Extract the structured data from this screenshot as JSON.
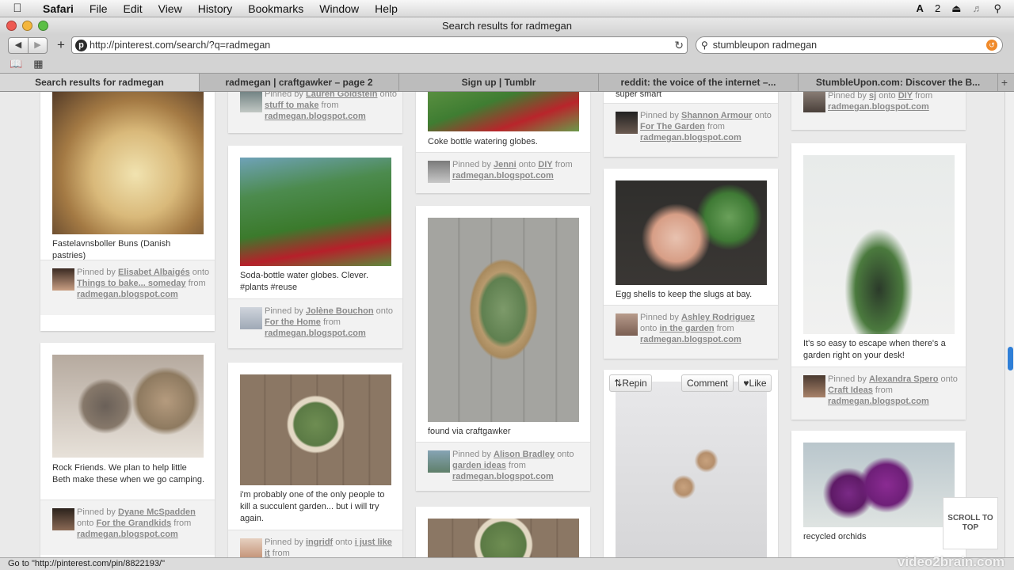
{
  "menubar": {
    "app": "Safari",
    "items": [
      "File",
      "Edit",
      "View",
      "History",
      "Bookmarks",
      "Window",
      "Help"
    ],
    "status_count": "2"
  },
  "window": {
    "title": "Search results for radmegan"
  },
  "toolbar": {
    "url": "http://pinterest.com/search/?q=radmegan",
    "search_value": "stumbleupon radmegan"
  },
  "tabs": [
    "Search results for radmegan",
    "radmegan | craftgawker – page 2",
    "Sign up | Tumblr",
    "reddit: the voice of the internet –...",
    "StumbleUpon.com: Discover the B..."
  ],
  "pins": {
    "c1_top": {
      "desc": "Fastelavnsboller Buns (Danish pastries)",
      "pinned_by": "Elisabet Albaigés",
      "board": "Things to bake... someday",
      "source": "radmegan.blogspot.com"
    },
    "c1_bottom": {
      "desc": "Rock Friends. We plan to help little Beth make these when we go camping.",
      "pinned_by": "Dyane McSpadden",
      "board": "For the Grandkids",
      "source": "radmegan.blogspot.com"
    },
    "c2_top": {
      "pinned_by": "Lauren Goldstein",
      "board": "stuff to make",
      "source": "radmegan.blogspot.com"
    },
    "c2_mid": {
      "desc": "Soda-bottle water globes. Clever. #plants #reuse",
      "pinned_by": "Jolène Bouchon",
      "board": "For the Home",
      "source": "radmegan.blogspot.com"
    },
    "c2_bottom": {
      "desc": "i'm probably one of the only people to kill a succulent garden... but i will try again.",
      "pinned_by": "ingridf",
      "board": "i just like it",
      "from": "from"
    },
    "c3_top": {
      "desc": "Coke bottle watering globes.",
      "pinned_by": "Jenni",
      "board": "DIY",
      "source": "radmegan.blogspot.com"
    },
    "c3_mid": {
      "desc": "found via craftgawker",
      "pinned_by": "Alison Bradley",
      "board": "garden ideas",
      "source": "radmegan.blogspot.com"
    },
    "c4_top": {
      "desc_tail": "super smart",
      "pinned_by": "Shannon Armour",
      "board": "For The Garden",
      "source": "radmegan.blogspot.com"
    },
    "c4_mid": {
      "desc": "Egg shells to keep the slugs at bay.",
      "pinned_by": "Ashley Rodriguez",
      "board": "in the garden",
      "source": "radmegan.blogspot.com"
    },
    "c4_bottom": {
      "repin": "Repin",
      "comment": "Comment",
      "like": "Like"
    },
    "c5_top": {
      "pinned_by": "sj",
      "board": "DIY",
      "source": "radmegan.blogspot.com"
    },
    "c5_mid": {
      "desc": "It's so easy to escape when there's a garden right on your desk!",
      "pinned_by": "Alexandra Spero",
      "board": "Craft Ideas",
      "source": "radmegan.blogspot.com"
    },
    "c5_bottom": {
      "desc": "recycled orchids"
    }
  },
  "text": {
    "pinned_by": "Pinned by",
    "onto": "onto",
    "from": "from"
  },
  "scroll_to_top": "SCROLL TO TOP",
  "status": "Go to \"http://pinterest.com/pin/8822193/\"",
  "watermark": "video2brain.com"
}
